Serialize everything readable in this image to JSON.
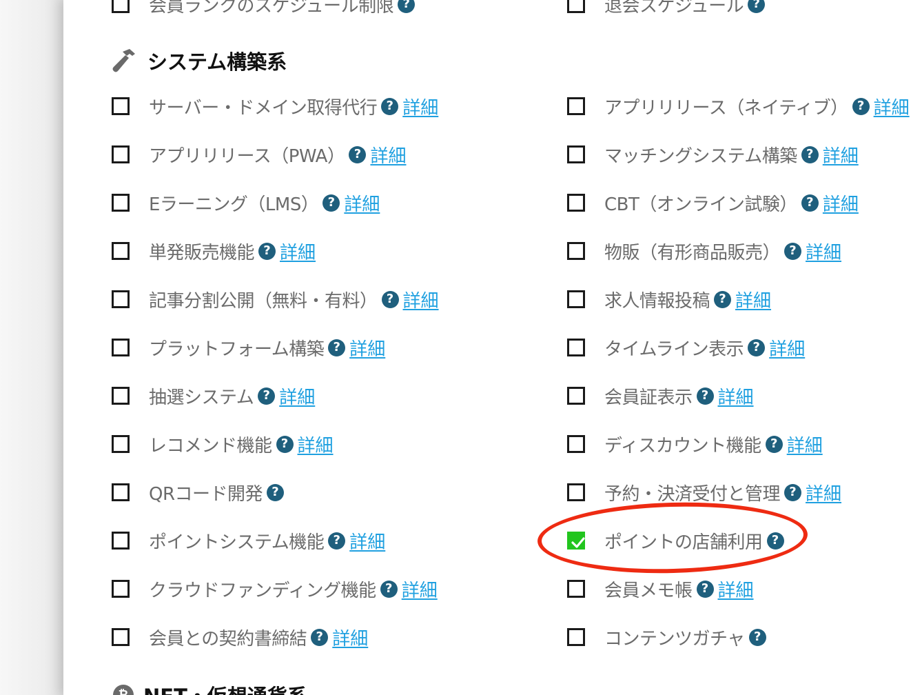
{
  "top_partial": {
    "left_label": "会員ランクのスケジュール制限",
    "right_label": "退会スケジュール"
  },
  "section": {
    "title": "システム構築系",
    "icon": "hammer-icon"
  },
  "next_section": {
    "title": "NFT・仮想通貨系",
    "icon": "bitcoin-icon"
  },
  "detail_link_text": "詳細",
  "help_glyph": "?",
  "left_items": [
    {
      "label": "サーバー・ドメイン取得代行",
      "checked": false,
      "link": "詳細"
    },
    {
      "label": "アプリリリース（PWA）",
      "checked": false,
      "link": "詳細"
    },
    {
      "label": "Eラーニング（LMS）",
      "checked": false,
      "link": "詳細"
    },
    {
      "label": "単発販売機能",
      "checked": false,
      "link": "詳細"
    },
    {
      "label": "記事分割公開（無料・有料）",
      "checked": false,
      "link": "詳細"
    },
    {
      "label": "プラットフォーム構築",
      "checked": false,
      "link": "詳細"
    },
    {
      "label": "抽選システム",
      "checked": false,
      "link": "詳細"
    },
    {
      "label": "レコメンド機能",
      "checked": false,
      "link": "詳細"
    },
    {
      "label": "QRコード開発",
      "checked": false,
      "link": null
    },
    {
      "label": "ポイントシステム機能",
      "checked": false,
      "link": "詳細"
    },
    {
      "label": "クラウドファンディング機能",
      "checked": false,
      "link": "詳細"
    },
    {
      "label": "会員との契約書締結",
      "checked": false,
      "link": "詳細"
    }
  ],
  "right_items": [
    {
      "label": "アプリリリース（ネイティブ）",
      "checked": false,
      "link": "詳細"
    },
    {
      "label": "マッチングシステム構築",
      "checked": false,
      "link": "詳細"
    },
    {
      "label": "CBT（オンライン試験）",
      "checked": false,
      "link": "詳細"
    },
    {
      "label": "物販（有形商品販売）",
      "checked": false,
      "link": "詳細"
    },
    {
      "label": "求人情報投稿",
      "checked": false,
      "link": "詳細"
    },
    {
      "label": "タイムライン表示",
      "checked": false,
      "link": "詳細"
    },
    {
      "label": "会員証表示",
      "checked": false,
      "link": "詳細"
    },
    {
      "label": "ディスカウント機能",
      "checked": false,
      "link": "詳細"
    },
    {
      "label": "予約・決済受付と管理",
      "checked": false,
      "link": "詳細"
    },
    {
      "label": "ポイントの店舗利用",
      "checked": true,
      "link": null
    },
    {
      "label": "会員メモ帳",
      "checked": false,
      "link": "詳細"
    },
    {
      "label": "コンテンツガチャ",
      "checked": false,
      "link": null
    }
  ],
  "colors": {
    "accent_link": "#1fa0e0",
    "help_icon": "#1f5f7d",
    "checked": "#22c51e",
    "highlight": "#ee2b12"
  }
}
